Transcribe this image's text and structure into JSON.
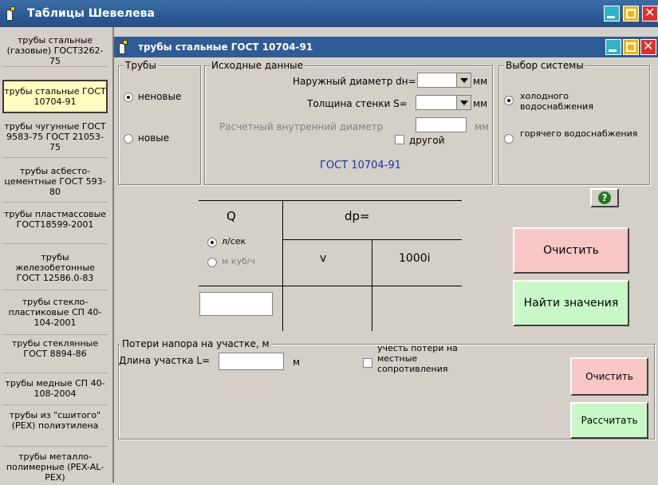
{
  "app": {
    "title": "Таблицы Шевелева"
  },
  "sidebar": {
    "items": [
      {
        "label": "трубы стальные (газовые) ГОСТ3262-75",
        "selected": false
      },
      {
        "label": "трубы стальные ГОСТ 10704-91",
        "selected": true
      },
      {
        "label": "трубы чугунные ГОСТ 9583-75 ГОСТ 21053-75",
        "selected": false
      },
      {
        "label": "трубы асбесто- цементные ГОСТ 593-80",
        "selected": false
      },
      {
        "label": "трубы пластмассовые ГОСТ18599-2001",
        "selected": false
      },
      {
        "label": "трубы железобетонные ГОСТ 12586.0-83",
        "selected": false
      },
      {
        "label": "трубы стекло- пластиковые СП 40-104-2001",
        "selected": false
      },
      {
        "label": "трубы стеклянные ГОСТ 8894-86",
        "selected": false
      },
      {
        "label": "трубы медные СП 40-108-2004",
        "selected": false
      },
      {
        "label": "трубы из \"сшитого\" (РЕХ) полиэтилена",
        "selected": false
      },
      {
        "label": "трубы металло- полимерные (PEX-AL-PEX)",
        "selected": false
      }
    ]
  },
  "child": {
    "title": "трубы стальные ГОСТ 10704-91"
  },
  "pipes_group": {
    "label": "Трубы",
    "options": [
      {
        "label": "неновые",
        "checked": true
      },
      {
        "label": "новые",
        "checked": false
      }
    ]
  },
  "input_group": {
    "label": "Исходные данные",
    "outer_diameter_label": "Наружный диаметр dн=",
    "outer_diameter_value": "",
    "outer_diameter_unit": "мм",
    "wall_label": "Толщина стенки S=",
    "wall_value": "",
    "wall_unit": "мм",
    "inner_label": "Расчетный внутренний диаметр",
    "inner_value": "",
    "inner_unit": "мм",
    "other_label": "другой",
    "standard": "ГОСТ 10704-91"
  },
  "system_group": {
    "label": "Выбор системы",
    "options": [
      {
        "label": "холодного водоснабжения",
        "checked": true
      },
      {
        "label": "горячего водоснабжения",
        "checked": false
      }
    ]
  },
  "table": {
    "q_header": "Q",
    "dp_header": "dp=",
    "unit_ls": "л/сек",
    "unit_m3h": "м куб/ч",
    "v_header": "v",
    "i_header": "1000i",
    "q_value": ""
  },
  "buttons": {
    "help": "?",
    "clear": "Очистить",
    "find": "Найти значения",
    "clear2": "Очистить",
    "calculate": "Рассчитать"
  },
  "losses_group": {
    "label": "Потери напора на участке, м",
    "length_label": "Длина участка L=",
    "length_value": "",
    "length_unit": "м",
    "local_losses_label": "учесть потери на местные сопротивления"
  },
  "colors": {
    "title_bg": "#2a5a95",
    "selected_item": "#fffec0",
    "clear_button": "#f9c6c6",
    "find_button": "#c8f8c8"
  }
}
